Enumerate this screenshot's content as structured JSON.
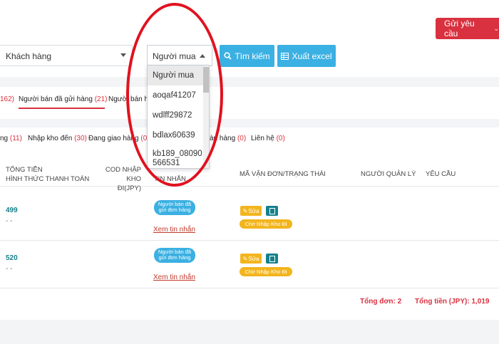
{
  "header": {
    "send_request_label": "Gửi yêu cầu"
  },
  "filters": {
    "customer_select": "Khách hàng",
    "buyer_select": "Người mua",
    "search_button": "Tìm kiếm",
    "excel_button": "Xuất excel"
  },
  "dropdown": {
    "options": [
      "Người mua",
      "aoqaf41207",
      "wdlff29872",
      "bdlax60639",
      "kb189_08090",
      "566531"
    ]
  },
  "tabs": [
    {
      "count": "162)"
    },
    {
      "label": "Người bán đã gửi hàng",
      "count": "(21)"
    },
    {
      "label": "Người bán h"
    }
  ],
  "statuses": [
    {
      "label": "ng",
      "count": "(11)"
    },
    {
      "label": "Nhập kho đến",
      "count": "(30)"
    },
    {
      "label": "Đang giao hàng",
      "count": "(0)"
    },
    {
      "label": "àn hàng",
      "count": "(0)"
    },
    {
      "label": "Liên hệ",
      "count": "(0)"
    }
  ],
  "table": {
    "headers": {
      "total": "TỔNG TIỀN",
      "payment": "HÌNH THỨC THANH TOÁN",
      "cod_1": "COD NHẬP",
      "cod_2": "KHO ĐI(JPY)",
      "hidden_1": "",
      "message": "TIN NHẮN",
      "tracking": "MÃ VẬN ĐƠN/TRẠNG THÁI",
      "manager": "NGƯỜI QUẢN LÝ",
      "request": "YÊU CẦU"
    },
    "rows": [
      {
        "amount": "499",
        "payment": "- -",
        "status_1": "Người bán đã",
        "status_2": "gửi đơn hàng",
        "link": "Xem tin nhắn",
        "edit": "Sửa",
        "state": "Chờ Nhập Kho Đi"
      },
      {
        "amount": "520",
        "payment": "- -",
        "status_1": "Người bán đã",
        "status_2": "gửi đơn hàng",
        "link": "Xem tin nhắn",
        "edit": "Sửa",
        "state": "Chờ Nhập Kho Đi"
      }
    ]
  },
  "totals": {
    "orders": "Tổng đơn: 2",
    "amount": "Tổng tiền (JPY): 1,019"
  },
  "colors": {
    "accent_red": "#d9313f",
    "blue": "#3bb0e2",
    "teal": "#16808c",
    "yellow": "#f3b51d",
    "annotation": "#e0121f"
  }
}
